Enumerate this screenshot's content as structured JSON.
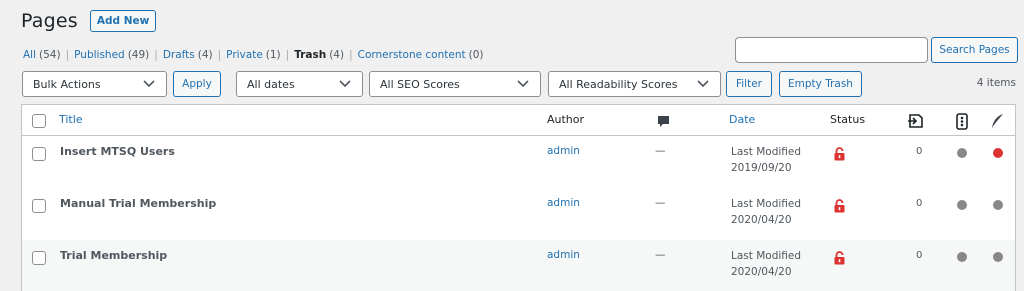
{
  "header": {
    "title": "Pages",
    "add_new_label": "Add New"
  },
  "views": [
    {
      "label": "All",
      "count": "(54)",
      "current": false
    },
    {
      "label": "Published",
      "count": "(49)",
      "current": false
    },
    {
      "label": "Drafts",
      "count": "(4)",
      "current": false
    },
    {
      "label": "Private",
      "count": "(1)",
      "current": false
    },
    {
      "label": "Trash",
      "count": "(4)",
      "current": true
    },
    {
      "label": "Cornerstone content",
      "count": "(0)",
      "current": false
    }
  ],
  "search": {
    "value": "",
    "button_label": "Search Pages"
  },
  "tablenav": {
    "bulk_actions": "Bulk Actions",
    "apply_label": "Apply",
    "dates_filter": "All dates",
    "seo_filter": "All SEO Scores",
    "readability_filter": "All Readability Scores",
    "filter_label": "Filter",
    "empty_trash_label": "Empty Trash",
    "items_count": "4 items"
  },
  "columns": {
    "title": "Title",
    "author": "Author",
    "date": "Date",
    "status": "Status"
  },
  "rows": [
    {
      "title": "Insert MTSQ Users",
      "author": "admin",
      "comments": "—",
      "date_label": "Last Modified",
      "date": "2019/09/20",
      "links": "0",
      "seo_color": "#888888",
      "readability_color": "#dc3232"
    },
    {
      "title": "Manual Trial Membership",
      "author": "admin",
      "comments": "—",
      "date_label": "Last Modified",
      "date": "2020/04/20",
      "links": "0",
      "seo_color": "#888888",
      "readability_color": "#888888"
    },
    {
      "title": "Trial Membership",
      "author": "admin",
      "comments": "—",
      "date_label": "Last Modified",
      "date": "2020/04/20",
      "links": "0",
      "seo_color": "#888888",
      "readability_color": "#888888"
    }
  ],
  "colors": {
    "link": "#2271b1",
    "lock": "#dc3232",
    "dot_gray": "#888888",
    "dot_red": "#dc3232"
  }
}
